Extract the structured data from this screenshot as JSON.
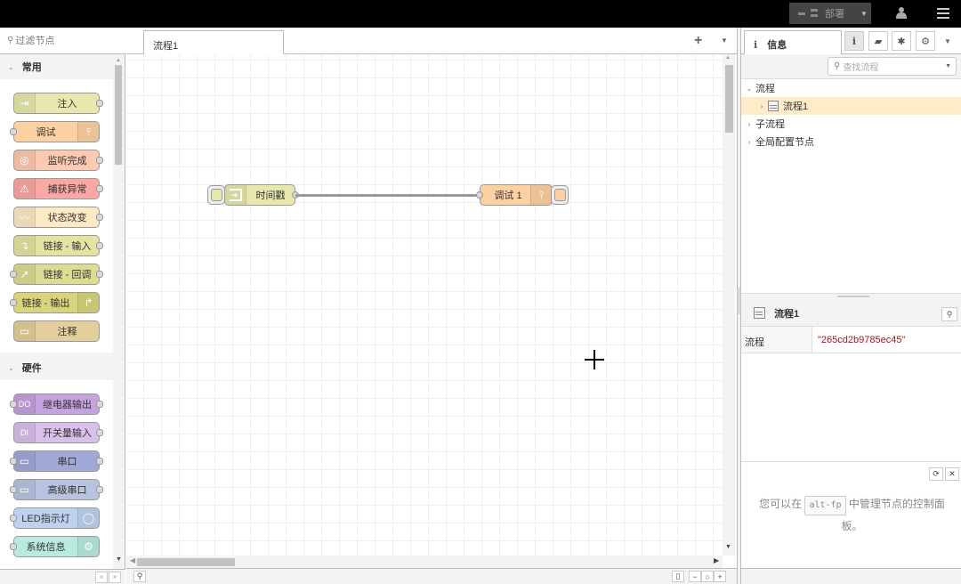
{
  "header": {
    "deploy_label": "部署",
    "deploy_icon": "deploy-icon",
    "user_icon": "user-icon",
    "menu_icon": "menu-icon"
  },
  "palette": {
    "search_placeholder": "过滤节点",
    "categories": [
      {
        "label": "常用",
        "expanded": true,
        "nodes": [
          {
            "label": "注入",
            "color": "#e7e7ae",
            "icon": "inject-icon",
            "icon_side": "left",
            "in": false,
            "out": true
          },
          {
            "label": "调试",
            "color": "#fdd0a2",
            "icon": "debug-icon",
            "icon_side": "right",
            "in": true,
            "out": false
          },
          {
            "label": "监听完成",
            "color": "#fdc9b0",
            "icon": "complete-icon",
            "icon_side": "left",
            "in": false,
            "out": true
          },
          {
            "label": "捕获异常",
            "color": "#f9a8a3",
            "icon": "alert-icon",
            "icon_side": "left",
            "in": false,
            "out": true
          },
          {
            "label": "状态改变",
            "color": "#fde9c4",
            "icon": "status-icon",
            "icon_side": "left",
            "in": false,
            "out": true
          },
          {
            "label": "链接 - 输入",
            "color": "#e3e4a2",
            "icon": "link-in-icon",
            "icon_side": "left",
            "in": false,
            "out": true
          },
          {
            "label": "链接 - 回调",
            "color": "#dcdc94",
            "icon": "link-call-icon",
            "icon_side": "left",
            "in": true,
            "out": true
          },
          {
            "label": "链接 - 输出",
            "color": "#d8d47c",
            "icon": "link-out-icon",
            "icon_side": "right",
            "in": true,
            "out": false
          },
          {
            "label": "注释",
            "color": "#e4cf9c",
            "icon": "comment-icon",
            "icon_side": "left",
            "in": false,
            "out": false
          }
        ]
      },
      {
        "label": "硬件",
        "expanded": true,
        "nodes": [
          {
            "label": "继电器输出",
            "color": "#c5a2e0",
            "icon": "relay-out-icon",
            "icon_side": "left",
            "in": true,
            "out": true
          },
          {
            "label": "开关量输入",
            "color": "#d9c0ea",
            "icon": "switch-in-icon",
            "icon_side": "left",
            "in": false,
            "out": true
          },
          {
            "label": "串口",
            "color": "#a2a8d6",
            "icon": "serial-icon",
            "icon_side": "left",
            "in": true,
            "out": true
          },
          {
            "label": "高级串口",
            "color": "#b9c3e0",
            "icon": "serial-icon",
            "icon_side": "left",
            "in": true,
            "out": true
          },
          {
            "label": "LED指示灯",
            "color": "#bed2f0",
            "icon": "bulb-icon",
            "icon_side": "right",
            "in": true,
            "out": false
          },
          {
            "label": "系统信息",
            "color": "#b8eadf",
            "icon": "gear-icon",
            "icon_side": "right",
            "in": true,
            "out": false
          }
        ]
      }
    ]
  },
  "workspace": {
    "tabs": [
      {
        "label": "流程1",
        "active": true
      }
    ],
    "add_tab_icon": "plus-icon",
    "tab_menu_icon": "caret-down-icon",
    "nodes": [
      {
        "id": "inject",
        "label": "时间戳",
        "color": "#e7e7ae",
        "icon": "inject-icon"
      },
      {
        "id": "debug",
        "label": "调试 1",
        "color": "#fdd0a2",
        "icon": "debug-icon"
      }
    ],
    "wires": [
      {
        "from": "inject",
        "to": "debug"
      }
    ]
  },
  "sidebar": {
    "active_tab": "信息",
    "tab_icons": [
      "info-icon",
      "book-icon",
      "bug-icon",
      "gear-icon"
    ],
    "flow_search_placeholder": "查找流程",
    "tree": [
      {
        "label": "流程",
        "expanded": true,
        "level": 0
      },
      {
        "label": "流程1",
        "expanded": false,
        "level": 1,
        "selected": true
      },
      {
        "label": "子流程",
        "expanded": false,
        "level": 0
      },
      {
        "label": "全局配置节点",
        "expanded": false,
        "level": 0
      }
    ],
    "info": {
      "title": "流程1",
      "props": [
        {
          "key": "流程",
          "value": "\"265cd2b9785ec45\""
        }
      ]
    },
    "help": {
      "text_before": "您可以在",
      "shortcut": "alt-fp",
      "text_after": "中管理节点的控制面板。"
    }
  }
}
